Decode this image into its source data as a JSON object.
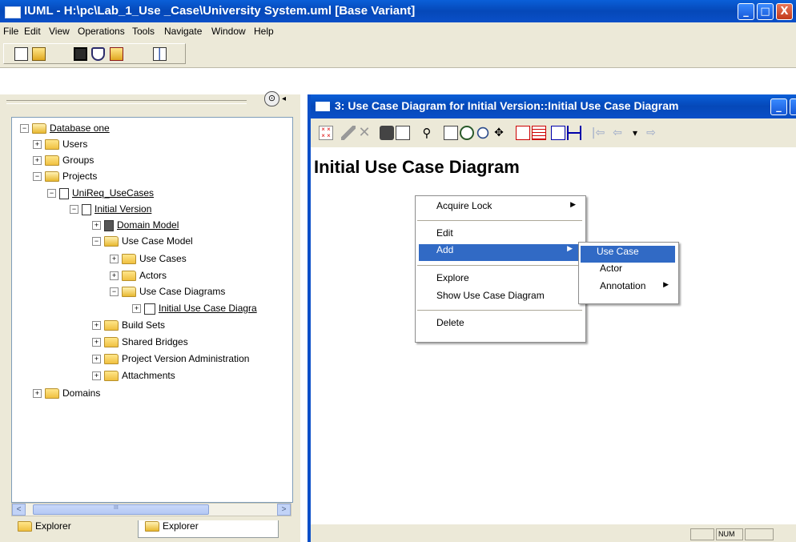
{
  "window": {
    "title": "IUML - H:\\pc\\Lab_1_Use _Case\\University System.uml [Base Variant]",
    "controls": {
      "minimize": "_",
      "maximize": "□",
      "close": "X"
    }
  },
  "menubar": [
    "File",
    "Edit",
    "View",
    "Operations",
    "Tools",
    "Navigate",
    "Window",
    "Help"
  ],
  "toolbar": [
    "new-icon",
    "open-icon",
    "save-icon",
    "shape-icon",
    "open-folder-icon",
    "compare-icon"
  ],
  "explorer": {
    "pin_icon": "⊙",
    "collapse_arrow": "◂",
    "tree": [
      {
        "label": "Database one",
        "underline": true,
        "icon": "folder-open",
        "expander": "−",
        "level": 0
      },
      {
        "label": "Users",
        "icon": "folder",
        "expander": "+",
        "level": 1
      },
      {
        "label": "Groups",
        "icon": "folder",
        "expander": "+",
        "level": 1
      },
      {
        "label": "Projects",
        "icon": "folder-open",
        "expander": "−",
        "level": 1
      },
      {
        "label": "UniReq_UseCases",
        "underline": true,
        "icon": "doc",
        "expander": "−",
        "level": 2
      },
      {
        "label": "Initial Version",
        "underline": true,
        "icon": "doc",
        "expander": "−",
        "level": 3
      },
      {
        "label": "Domain Model",
        "underline": true,
        "icon": "doc-dark",
        "expander": "+",
        "level": 4
      },
      {
        "label": "Use Case Model",
        "icon": "folder-open",
        "expander": "−",
        "level": 4
      },
      {
        "label": "Use Cases",
        "icon": "folder",
        "expander": "+",
        "level": 5
      },
      {
        "label": "Actors",
        "icon": "folder",
        "expander": "+",
        "level": 5
      },
      {
        "label": "Use Case Diagrams",
        "icon": "folder-open",
        "expander": "−",
        "level": 5
      },
      {
        "label": "Initial Use Case Diagra",
        "underline": true,
        "icon": "diagram",
        "expander": "+",
        "level": 6
      },
      {
        "label": "Build Sets",
        "icon": "folder",
        "expander": "+",
        "level": 4
      },
      {
        "label": "Shared Bridges",
        "icon": "folder",
        "expander": "+",
        "level": 4
      },
      {
        "label": "Project Version Administration",
        "icon": "folder",
        "expander": "+",
        "level": 4
      },
      {
        "label": "Attachments",
        "icon": "folder",
        "expander": "+",
        "level": 4
      },
      {
        "label": "Domains",
        "icon": "folder",
        "expander": "+",
        "level": 0
      }
    ],
    "scroll": {
      "left": "<",
      "right": ">",
      "grip": "III"
    },
    "tabs": [
      "Explorer",
      "Explorer"
    ]
  },
  "diagram_window": {
    "title": "3: Use Case Diagram for Initial Version::Initial Use Case Diagram",
    "minimize": "_",
    "heading": "Initial Use Case Diagram",
    "status": [
      "NUM"
    ]
  },
  "context_menu": {
    "items": [
      {
        "label": "Acquire Lock",
        "submenu": true
      },
      {
        "label": "Edit"
      },
      {
        "label": "Add",
        "submenu": true,
        "selected": true
      },
      {
        "label": "Explore"
      },
      {
        "label": "Show Use Case Diagram"
      },
      {
        "label": "Delete"
      }
    ]
  },
  "add_submenu": {
    "items": [
      {
        "label": "Use Case",
        "selected": true
      },
      {
        "label": "Actor"
      },
      {
        "label": "Annotation",
        "submenu": true
      }
    ]
  },
  "submenu_arrow": "▶",
  "colors": {
    "title_blue": "#0a4fc8",
    "menu_highlight": "#316ac5",
    "chrome": "#ece9d8",
    "folder_yellow": "#f0c040"
  }
}
